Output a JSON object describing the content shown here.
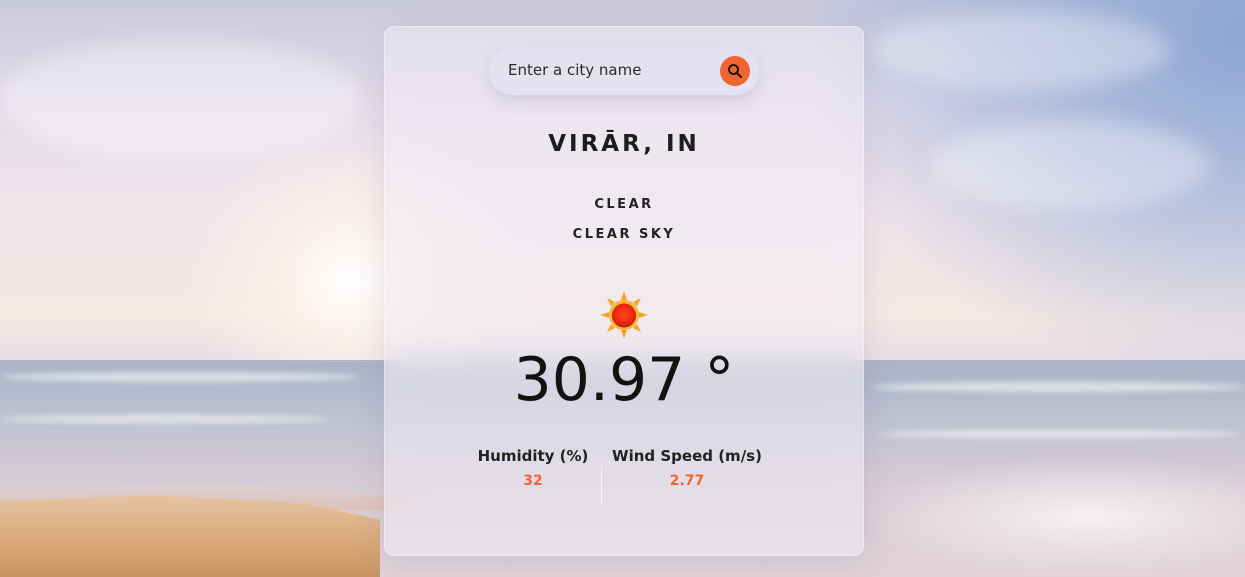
{
  "search": {
    "placeholder": "Enter a city name",
    "value": ""
  },
  "location": {
    "city": "VIRĀR, IN"
  },
  "condition": {
    "main": "CLEAR",
    "description": "CLEAR SKY",
    "icon": "sun-icon"
  },
  "temperature": {
    "value": "30.97 °"
  },
  "stats": {
    "humidity_label": "Humidity (%)",
    "humidity_value": "32",
    "wind_label": "Wind Speed (m/s)",
    "wind_value": "2.77"
  },
  "colors": {
    "accent": "#ef6431"
  }
}
